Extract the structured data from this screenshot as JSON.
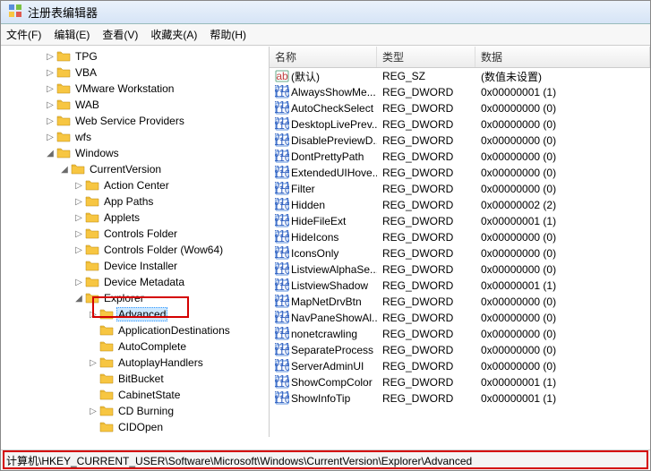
{
  "title": "注册表编辑器",
  "menu": {
    "file": "文件(F)",
    "edit": "编辑(E)",
    "view": "查看(V)",
    "favorites": "收藏夹(A)",
    "help": "帮助(H)"
  },
  "tree": [
    {
      "depth": 3,
      "expander": "▷",
      "label": "TPG"
    },
    {
      "depth": 3,
      "expander": "▷",
      "label": "VBA"
    },
    {
      "depth": 3,
      "expander": "▷",
      "label": "VMware Workstation"
    },
    {
      "depth": 3,
      "expander": "▷",
      "label": "WAB"
    },
    {
      "depth": 3,
      "expander": "▷",
      "label": "Web Service Providers"
    },
    {
      "depth": 3,
      "expander": "▷",
      "label": "wfs"
    },
    {
      "depth": 3,
      "expander": "◢",
      "label": "Windows"
    },
    {
      "depth": 4,
      "expander": "◢",
      "label": "CurrentVersion"
    },
    {
      "depth": 5,
      "expander": "▷",
      "label": "Action Center"
    },
    {
      "depth": 5,
      "expander": "▷",
      "label": "App Paths"
    },
    {
      "depth": 5,
      "expander": "▷",
      "label": "Applets"
    },
    {
      "depth": 5,
      "expander": "▷",
      "label": "Controls Folder"
    },
    {
      "depth": 5,
      "expander": "▷",
      "label": "Controls Folder (Wow64)"
    },
    {
      "depth": 5,
      "expander": "",
      "label": "Device Installer"
    },
    {
      "depth": 5,
      "expander": "▷",
      "label": "Device Metadata"
    },
    {
      "depth": 5,
      "expander": "◢",
      "label": "Explorer"
    },
    {
      "depth": 6,
      "expander": "▷",
      "label": "Advanced",
      "selected": true
    },
    {
      "depth": 6,
      "expander": "",
      "label": "ApplicationDestinations"
    },
    {
      "depth": 6,
      "expander": "",
      "label": "AutoComplete"
    },
    {
      "depth": 6,
      "expander": "▷",
      "label": "AutoplayHandlers"
    },
    {
      "depth": 6,
      "expander": "",
      "label": "BitBucket"
    },
    {
      "depth": 6,
      "expander": "",
      "label": "CabinetState"
    },
    {
      "depth": 6,
      "expander": "▷",
      "label": "CD Burning"
    },
    {
      "depth": 6,
      "expander": "",
      "label": "CIDOpen"
    }
  ],
  "columns": {
    "name": "名称",
    "type": "类型",
    "data": "数据"
  },
  "values": [
    {
      "icon": "string",
      "name": "(默认)",
      "type": "REG_SZ",
      "data": "(数值未设置)"
    },
    {
      "icon": "dword",
      "name": "AlwaysShowMe...",
      "type": "REG_DWORD",
      "data": "0x00000001 (1)"
    },
    {
      "icon": "dword",
      "name": "AutoCheckSelect",
      "type": "REG_DWORD",
      "data": "0x00000000 (0)"
    },
    {
      "icon": "dword",
      "name": "DesktopLivePrev...",
      "type": "REG_DWORD",
      "data": "0x00000000 (0)"
    },
    {
      "icon": "dword",
      "name": "DisablePreviewD...",
      "type": "REG_DWORD",
      "data": "0x00000000 (0)"
    },
    {
      "icon": "dword",
      "name": "DontPrettyPath",
      "type": "REG_DWORD",
      "data": "0x00000000 (0)"
    },
    {
      "icon": "dword",
      "name": "ExtendedUIHove...",
      "type": "REG_DWORD",
      "data": "0x00000000 (0)"
    },
    {
      "icon": "dword",
      "name": "Filter",
      "type": "REG_DWORD",
      "data": "0x00000000 (0)"
    },
    {
      "icon": "dword",
      "name": "Hidden",
      "type": "REG_DWORD",
      "data": "0x00000002 (2)"
    },
    {
      "icon": "dword",
      "name": "HideFileExt",
      "type": "REG_DWORD",
      "data": "0x00000001 (1)"
    },
    {
      "icon": "dword",
      "name": "HideIcons",
      "type": "REG_DWORD",
      "data": "0x00000000 (0)"
    },
    {
      "icon": "dword",
      "name": "IconsOnly",
      "type": "REG_DWORD",
      "data": "0x00000000 (0)"
    },
    {
      "icon": "dword",
      "name": "ListviewAlphaSe...",
      "type": "REG_DWORD",
      "data": "0x00000000 (0)"
    },
    {
      "icon": "dword",
      "name": "ListviewShadow",
      "type": "REG_DWORD",
      "data": "0x00000001 (1)"
    },
    {
      "icon": "dword",
      "name": "MapNetDrvBtn",
      "type": "REG_DWORD",
      "data": "0x00000000 (0)"
    },
    {
      "icon": "dword",
      "name": "NavPaneShowAl...",
      "type": "REG_DWORD",
      "data": "0x00000000 (0)"
    },
    {
      "icon": "dword",
      "name": "nonetcrawling",
      "type": "REG_DWORD",
      "data": "0x00000000 (0)"
    },
    {
      "icon": "dword",
      "name": "SeparateProcess",
      "type": "REG_DWORD",
      "data": "0x00000000 (0)"
    },
    {
      "icon": "dword",
      "name": "ServerAdminUI",
      "type": "REG_DWORD",
      "data": "0x00000000 (0)"
    },
    {
      "icon": "dword",
      "name": "ShowCompColor",
      "type": "REG_DWORD",
      "data": "0x00000001 (1)"
    },
    {
      "icon": "dword",
      "name": "ShowInfoTip",
      "type": "REG_DWORD",
      "data": "0x00000001 (1)"
    }
  ],
  "status_path": "计算机\\HKEY_CURRENT_USER\\Software\\Microsoft\\Windows\\CurrentVersion\\Explorer\\Advanced"
}
